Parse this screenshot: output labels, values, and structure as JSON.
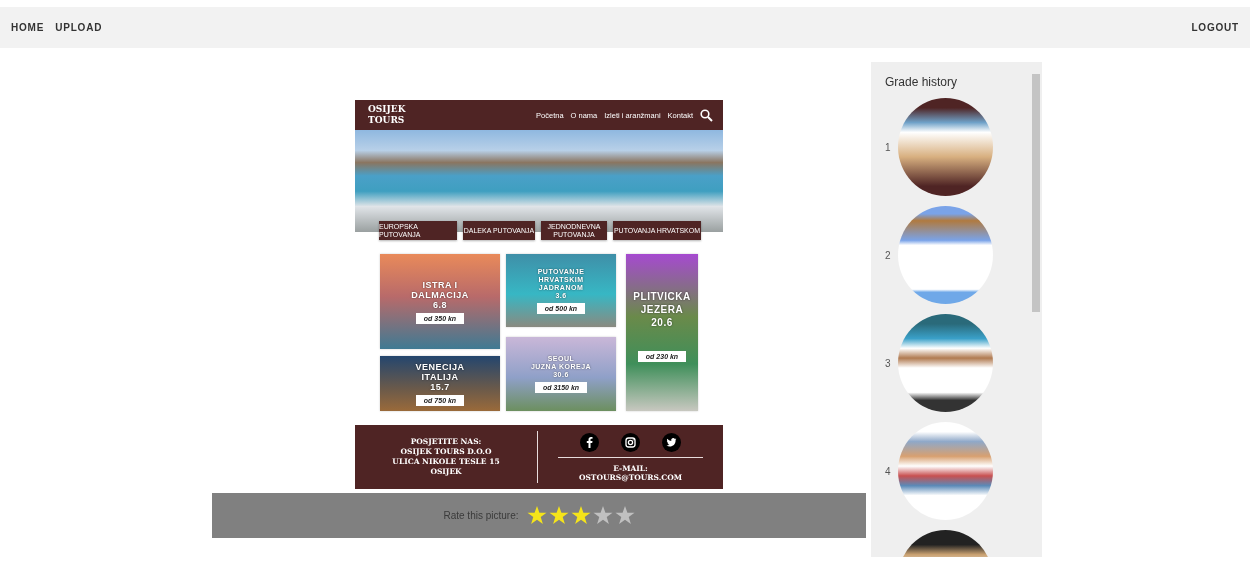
{
  "nav": {
    "links": [
      {
        "label": "HOME"
      },
      {
        "label": "UPLOAD"
      }
    ],
    "logout": "LOGOUT"
  },
  "mockup": {
    "logo_lines": [
      "OSIJEK",
      "TOURS"
    ],
    "nav_links": [
      "Početna",
      "O nama",
      "Izleti i aranžmani",
      "Kontakt"
    ],
    "category_buttons": [
      {
        "lines": [
          "EUROPSKA PUTOVANJA"
        ]
      },
      {
        "lines": [
          "DALEKA PUTOVANJA"
        ]
      },
      {
        "lines": [
          "JEDNODNEVNA",
          "PUTOVANJA"
        ]
      },
      {
        "lines": [
          "PUTOVANJA HRVATSKOM"
        ]
      }
    ],
    "card_columns": [
      [
        {
          "title_lines": [
            "ISTRA I",
            "DALMACIJA",
            "6.8"
          ],
          "price": "od 350 kn"
        },
        {
          "title_lines": [
            "VENECIJA",
            "ITALIJA",
            "15.7"
          ],
          "price": "od 750 kn"
        }
      ],
      [
        {
          "title_lines": [
            "PUTOVANJE",
            "HRVATSKIM",
            "JADRANOM",
            "3.6"
          ],
          "price": "od 500 kn"
        },
        {
          "title_lines": [
            "SEOUL",
            "JUZNA KOREJA",
            "30.6"
          ],
          "price": "od 3150 kn"
        }
      ],
      [
        {
          "title_lines": [
            "PLITVICKA",
            "JEZERA",
            "20.6"
          ],
          "price": "od 230 kn"
        }
      ]
    ],
    "footer": {
      "visit_lines": [
        "POSJETITE NAS:",
        "OSIJEK TOURS D.O.O",
        "ULICA NIKOLE TESLE 15",
        "OSIJEK"
      ],
      "email_lines": [
        "E-MAIL:",
        "OSTOURS@TOURS.COM"
      ]
    }
  },
  "rating": {
    "label": "Rate this picture:",
    "stars": 3
  },
  "history": {
    "title": "Grade history",
    "items": [
      {
        "kind": "graded",
        "number": "1"
      },
      {
        "kind": "graded",
        "number": "2"
      },
      {
        "kind": "graded",
        "number": "3"
      },
      {
        "kind": "graded",
        "number": "4"
      },
      {
        "kind": "partial"
      }
    ]
  }
}
